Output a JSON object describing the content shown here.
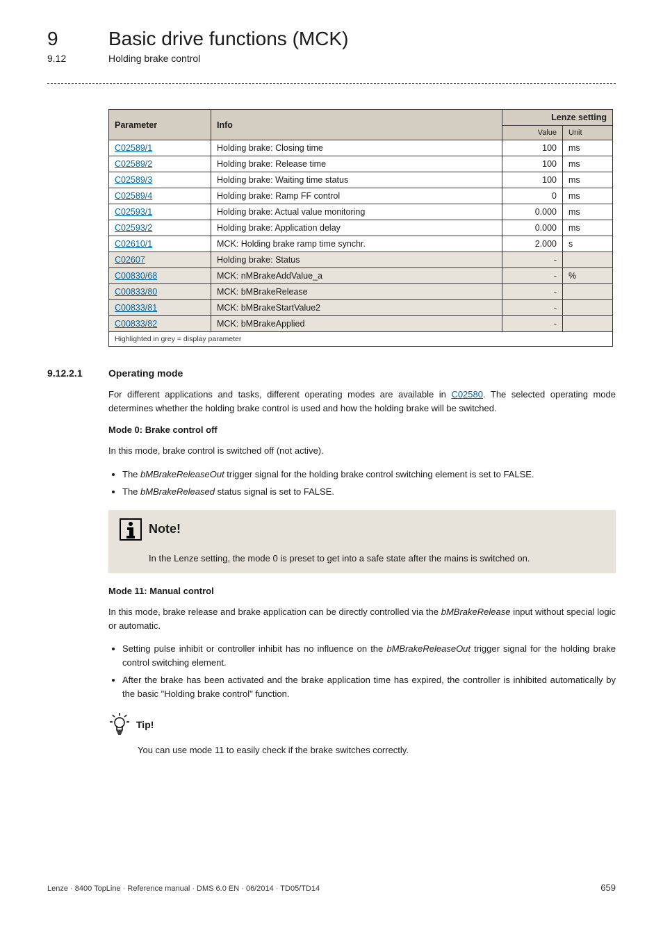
{
  "header": {
    "chapter_num": "9",
    "chapter_title": "Basic drive functions (MCK)",
    "section_num": "9.12",
    "section_title": "Holding brake control"
  },
  "table": {
    "headers": {
      "param": "Parameter",
      "info": "Info",
      "lenze": "Lenze setting"
    },
    "subheaders": {
      "value": "Value",
      "unit": "Unit"
    },
    "rows": [
      {
        "param": "C02589/1",
        "info": "Holding brake: Closing time",
        "value": "100",
        "unit": "ms",
        "grey": false
      },
      {
        "param": "C02589/2",
        "info": "Holding brake: Release time",
        "value": "100",
        "unit": "ms",
        "grey": false
      },
      {
        "param": "C02589/3",
        "info": "Holding brake: Waiting time status",
        "value": "100",
        "unit": "ms",
        "grey": false
      },
      {
        "param": "C02589/4",
        "info": "Holding brake: Ramp FF control",
        "value": "0",
        "unit": "ms",
        "grey": false
      },
      {
        "param": "C02593/1",
        "info": "Holding brake: Actual value monitoring",
        "value": "0.000",
        "unit": "ms",
        "grey": false
      },
      {
        "param": "C02593/2",
        "info": "Holding brake: Application delay",
        "value": "0.000",
        "unit": "ms",
        "grey": false
      },
      {
        "param": "C02610/1",
        "info": "MCK: Holding brake ramp time synchr.",
        "value": "2.000",
        "unit": "s",
        "grey": false
      },
      {
        "param": "C02607",
        "info": "Holding brake: Status",
        "value": "-",
        "unit": "",
        "grey": true
      },
      {
        "param": "C00830/68",
        "info": "MCK: nMBrakeAddValue_a",
        "value": "-",
        "unit": "%",
        "grey": true
      },
      {
        "param": "C00833/80",
        "info": "MCK: bMBrakeRelease",
        "value": "-",
        "unit": "",
        "grey": true
      },
      {
        "param": "C00833/81",
        "info": "MCK: bMBrakeStartValue2",
        "value": "-",
        "unit": "",
        "grey": true
      },
      {
        "param": "C00833/82",
        "info": "MCK: bMBrakeApplied",
        "value": "-",
        "unit": "",
        "grey": true
      }
    ],
    "footnote": "Highlighted in grey = display parameter"
  },
  "subsection": {
    "num": "9.12.2.1",
    "title": "Operating mode",
    "intro_before_link": "For different applications and tasks, different operating modes are available in ",
    "intro_link": "C02580",
    "intro_after_link": ". The selected operating mode determines whether the holding brake control is used and how the holding brake will be switched.",
    "mode0": {
      "heading": "Mode 0: Brake control off",
      "lead": "In this mode, brake control is switched off (not active).",
      "b1_pre": "The ",
      "b1_sig": "bMBrakeReleaseOut",
      "b1_post": " trigger signal for the holding brake control switching element is set to FALSE.",
      "b2_pre": "The ",
      "b2_sig": "bMBrakeReleased",
      "b2_post": " status signal is set to FALSE."
    },
    "note": {
      "title": "Note!",
      "body": "In the Lenze setting, the mode 0 is preset to get into a safe state after the mains is switched on."
    },
    "mode11": {
      "heading": "Mode 11: Manual control",
      "lead_pre": "In this mode, brake release and brake application can be directly controlled via the ",
      "lead_sig": "bMBrakeRelease",
      "lead_post": " input without special logic or automatic.",
      "b1_pre": "Setting pulse inhibit or controller inhibit has no influence on the ",
      "b1_sig": "bMBrakeReleaseOut",
      "b1_post": " trigger signal for the holding brake control switching element.",
      "b2": "After the brake has been activated and the brake application time has expired, the controller is inhibited automatically by the basic \"Holding brake control\" function."
    },
    "tip": {
      "title": "Tip!",
      "body": "You can use mode 11 to easily check if the brake switches correctly."
    }
  },
  "footer": {
    "left": "Lenze · 8400 TopLine · Reference manual · DMS 6.0 EN · 06/2014 · TD05/TD14",
    "page": "659"
  }
}
